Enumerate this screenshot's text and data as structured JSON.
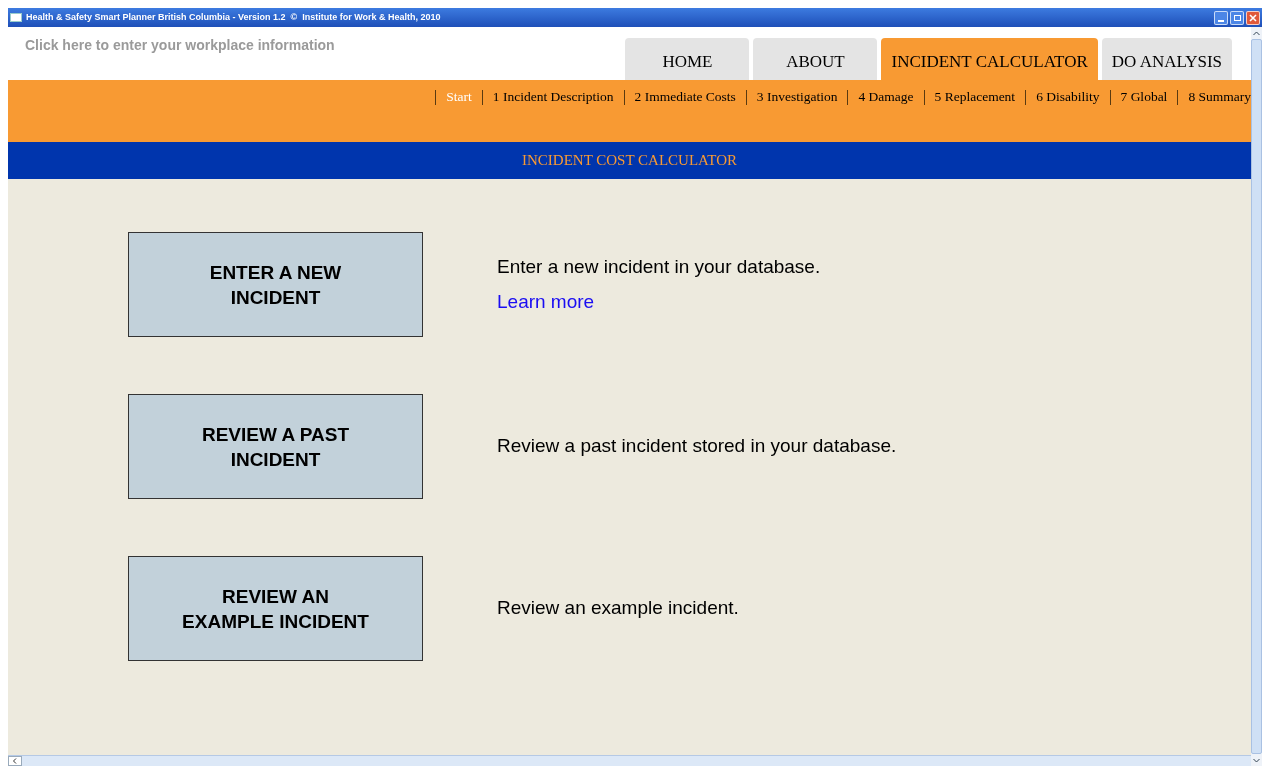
{
  "window": {
    "title": "Health & Safety Smart Planner British Columbia - Version 1.2  ©  Institute for Work & Health, 2010"
  },
  "workplace_link": "Click here to enter your workplace information",
  "tabs": [
    {
      "label": "HOME",
      "selected": false
    },
    {
      "label": "ABOUT",
      "selected": false
    },
    {
      "label": "INCIDENT CALCULATOR",
      "selected": true
    },
    {
      "label": "DO ANALYSIS",
      "selected": false
    }
  ],
  "steps": [
    {
      "label": "Start",
      "selected": true
    },
    {
      "label": "1 Incident Description",
      "selected": false
    },
    {
      "label": "2 Immediate Costs",
      "selected": false
    },
    {
      "label": "3 Investigation",
      "selected": false
    },
    {
      "label": "4 Damage",
      "selected": false
    },
    {
      "label": "5 Replacement",
      "selected": false
    },
    {
      "label": "6 Disability",
      "selected": false
    },
    {
      "label": "7 Global",
      "selected": false
    },
    {
      "label": "8 Summary",
      "selected": false
    }
  ],
  "section_title": "INCIDENT COST CALCULATOR",
  "actions": [
    {
      "button": "ENTER A NEW INCIDENT",
      "description": "Enter a new incident in your database.",
      "link": "Learn more"
    },
    {
      "button": "REVIEW A PAST INCIDENT",
      "description": "Review a past incident stored in your database."
    },
    {
      "button": "REVIEW AN EXAMPLE INCIDENT",
      "description": "Review an example incident."
    }
  ]
}
